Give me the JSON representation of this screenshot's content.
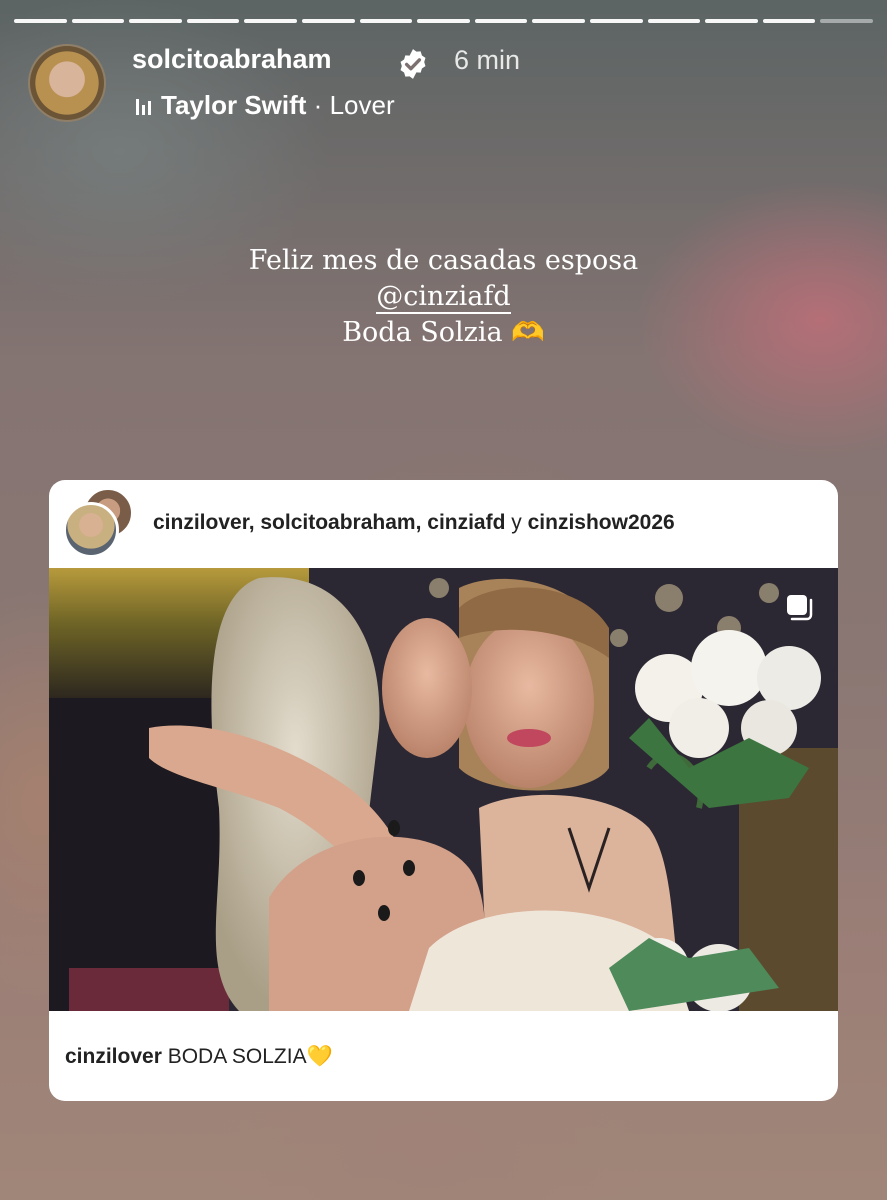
{
  "story": {
    "segments": 15,
    "user": {
      "username": "solcitoabraham",
      "time": "6 min",
      "verified": true
    },
    "music": {
      "artist": "Taylor Swift",
      "separator": "·",
      "song": "Lover"
    },
    "caption": {
      "line1": "Feliz mes de casadas esposa",
      "mention": "@cinziafd",
      "line3": "Boda Solzia 🫶"
    }
  },
  "post": {
    "collaborators_a": "cinzilover, solcitoabraham, cinziafd",
    "collaborators_y": "y",
    "collaborators_b": "cinzishow2026",
    "caption_user": "cinzilover",
    "caption_text": "BODA SOLZIA💛"
  },
  "icons": {
    "verified": "verified-badge-icon",
    "music": "music-bars-icon",
    "multi": "multiple-photos-icon"
  },
  "colors": {
    "text": "#ffffff",
    "card_bg": "#ffffff",
    "card_text": "#222222"
  }
}
